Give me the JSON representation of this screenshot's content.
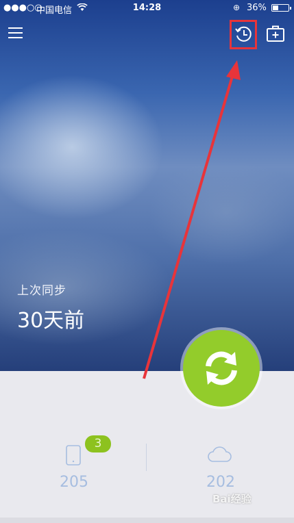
{
  "status_bar": {
    "signal": "●●●○○",
    "carrier": "中国电信",
    "time": "14:28",
    "lock_glyph": "⊕",
    "battery_percent": "36%",
    "battery_level": 0.36
  },
  "header": {
    "menu_icon": "hamburger-icon",
    "history_icon": "history-clock-icon",
    "toolbox_icon": "first-aid-kit-icon"
  },
  "sync_info": {
    "label": "上次同步",
    "value": "30天前"
  },
  "stats": {
    "local": {
      "icon": "phone-icon",
      "badge": "3",
      "count": "205"
    },
    "cloud": {
      "icon": "cloud-icon",
      "count": "202"
    }
  },
  "watermark": "Bai经验",
  "colors": {
    "accent_green": "#93cc2b",
    "annotation_red": "#e8343a",
    "count_blue": "#a6bde0"
  }
}
